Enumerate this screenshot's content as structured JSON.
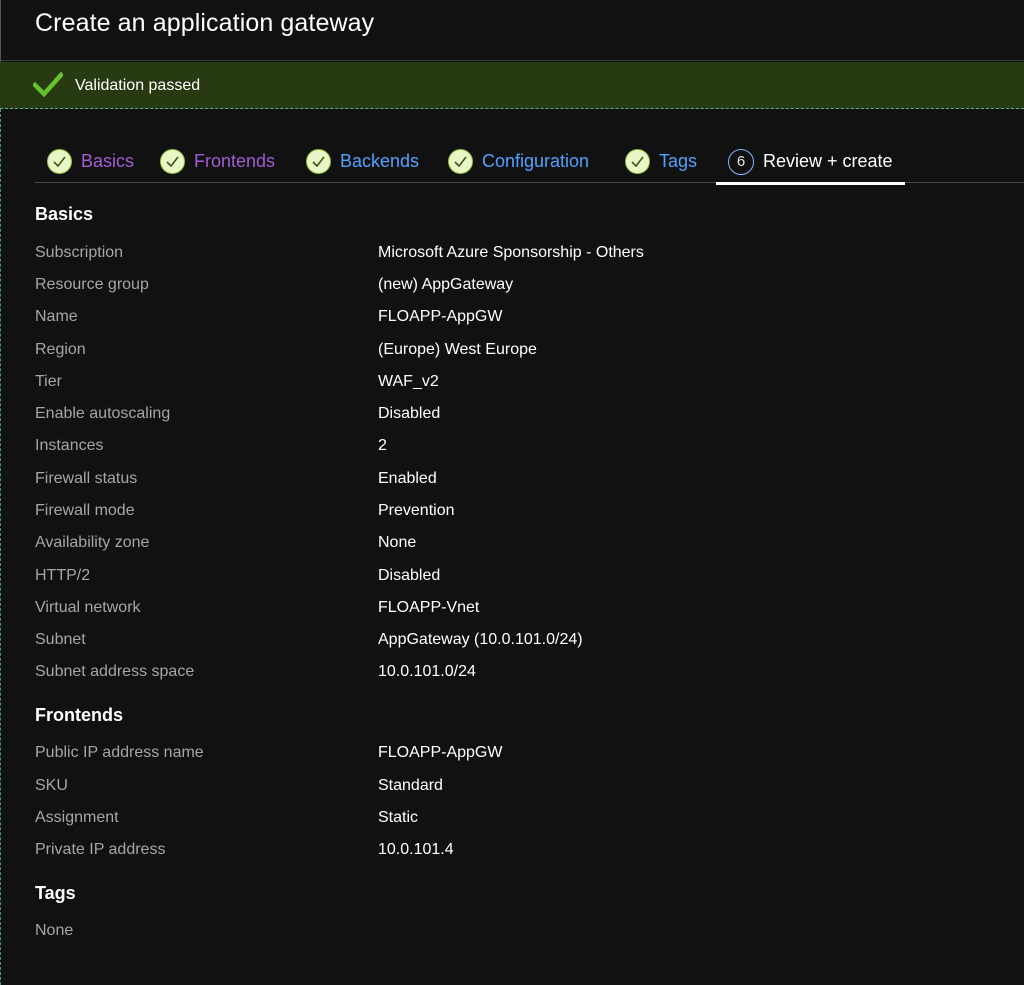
{
  "header": {
    "title": "Create an application gateway"
  },
  "banner": {
    "text": "Validation passed",
    "icon": "checkmark-icon",
    "color": "#273a12"
  },
  "colors": {
    "visited": "#a35bd6",
    "link": "#4ea2ff",
    "active": "#ffffff"
  },
  "tabs": [
    {
      "label": "Basics",
      "state": "completed"
    },
    {
      "label": "Frontends",
      "state": "completed"
    },
    {
      "label": "Backends",
      "state": "completed"
    },
    {
      "label": "Configuration",
      "state": "completed"
    },
    {
      "label": "Tags",
      "state": "completed"
    },
    {
      "label": "Review + create",
      "number": "6",
      "state": "active"
    }
  ],
  "basics": {
    "title": "Basics",
    "rows": [
      {
        "label": "Subscription",
        "value": "Microsoft Azure Sponsorship - Others"
      },
      {
        "label": "Resource group",
        "value": "(new) AppGateway"
      },
      {
        "label": "Name",
        "value": "FLOAPP-AppGW"
      },
      {
        "label": "Region",
        "value": "(Europe) West Europe"
      },
      {
        "label": "Tier",
        "value": "WAF_v2"
      },
      {
        "label": "Enable autoscaling",
        "value": "Disabled"
      },
      {
        "label": "Instances",
        "value": "2"
      },
      {
        "label": "Firewall status",
        "value": "Enabled"
      },
      {
        "label": "Firewall mode",
        "value": "Prevention"
      },
      {
        "label": "Availability zone",
        "value": "None"
      },
      {
        "label": "HTTP/2",
        "value": "Disabled"
      },
      {
        "label": "Virtual network",
        "value": "FLOAPP-Vnet"
      },
      {
        "label": "Subnet",
        "value": "AppGateway (10.0.101.0/24)"
      },
      {
        "label": "Subnet address space",
        "value": "10.0.101.0/24"
      }
    ]
  },
  "frontends": {
    "title": "Frontends",
    "rows": [
      {
        "label": "Public IP address name",
        "value": "FLOAPP-AppGW"
      },
      {
        "label": "SKU",
        "value": "Standard"
      },
      {
        "label": "Assignment",
        "value": "Static"
      },
      {
        "label": "Private IP address",
        "value": "10.0.101.4"
      }
    ]
  },
  "tags": {
    "title": "Tags",
    "text": "None"
  }
}
